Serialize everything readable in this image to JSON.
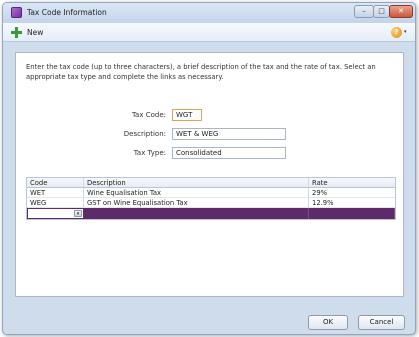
{
  "window": {
    "title": "Tax Code Information"
  },
  "window_controls": {
    "minimize": "–",
    "maximize": "□",
    "close": "✕"
  },
  "toolbar": {
    "new_label": "New",
    "help_glyph": "?",
    "help_drop": "▾"
  },
  "instructions": "Enter the tax code (up to three characters), a brief description of the tax and the rate of tax. Select an appropriate tax type and complete the links as necessary.",
  "form": {
    "tax_code_label": "Tax Code:",
    "tax_code_value": "WGT",
    "description_label": "Description:",
    "description_value": "WET & WEG",
    "tax_type_label": "Tax Type:",
    "tax_type_value": "Consolidated"
  },
  "grid": {
    "headers": {
      "code": "Code",
      "description": "Description",
      "rate": "Rate"
    },
    "rows": [
      {
        "code": "WET",
        "description": "Wine Equalisation Tax",
        "rate": "29%"
      },
      {
        "code": "WEG",
        "description": "GST on Wine Equalisation Tax",
        "rate": "12.9%"
      }
    ],
    "new_row_drop": "▾"
  },
  "buttons": {
    "ok": "OK",
    "cancel": "Cancel"
  },
  "icons": {
    "app": "app-icon",
    "new": "plus-icon",
    "help": "help-icon"
  }
}
